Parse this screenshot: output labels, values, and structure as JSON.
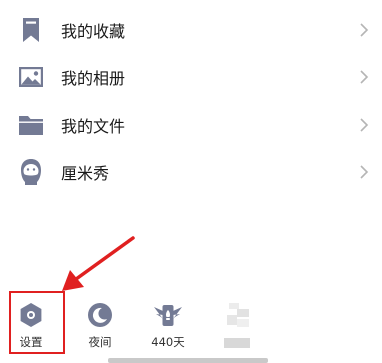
{
  "menu": {
    "items": [
      {
        "label": "我的收藏",
        "icon": "bookmark-icon"
      },
      {
        "label": "我的相册",
        "icon": "image-icon"
      },
      {
        "label": "我的文件",
        "icon": "folder-icon"
      },
      {
        "label": "厘米秀",
        "icon": "avatar-show-icon"
      }
    ]
  },
  "bottom_bar": {
    "items": [
      {
        "label": "设置",
        "icon": "settings-icon"
      },
      {
        "label": "夜间",
        "icon": "moon-icon"
      },
      {
        "label": "440天",
        "icon": "winged-badge-icon"
      },
      {
        "label": "",
        "icon": "blurred-icon"
      }
    ]
  },
  "colors": {
    "icon_gray": "#737a94",
    "highlight_red": "#e02020",
    "chevron": "#b5b5b5",
    "text": "#1a1a1a"
  }
}
